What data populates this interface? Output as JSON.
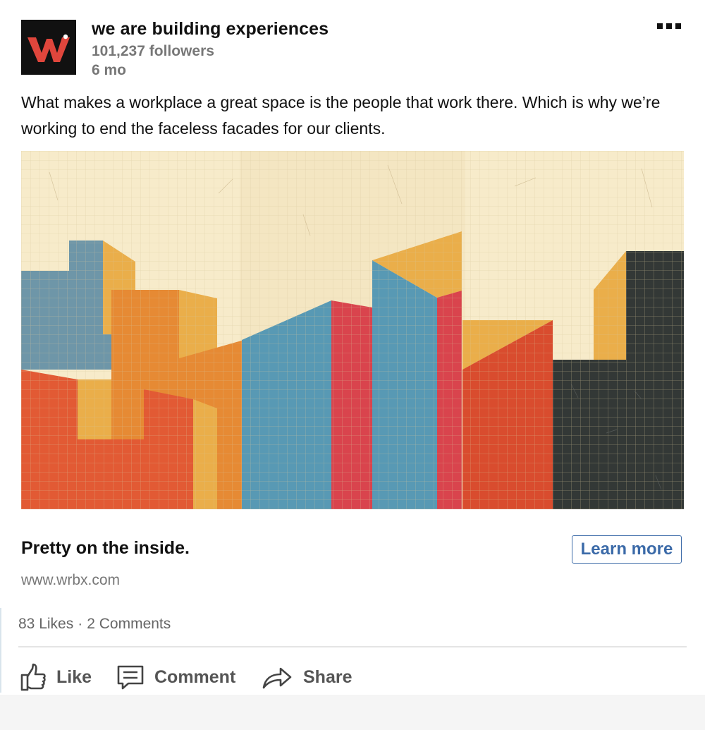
{
  "post": {
    "company_name": "we are building experiences",
    "followers": "101,237 followers",
    "age": "6 mo",
    "text": "What makes a workplace a great space is the people that work there. Which is why we’re working to end the faceless facades for our clients.",
    "logo_letter": "W",
    "more_icon": "ellipsis-icon"
  },
  "link_preview": {
    "headline": "Pretty on the inside.",
    "cta_label": "Learn more",
    "url": "www.wrbx.com"
  },
  "social": {
    "likes": "83 Likes",
    "separator": "·",
    "comments": "2 Comments"
  },
  "actions": {
    "like_label": "Like",
    "comment_label": "Comment",
    "share_label": "Share",
    "like_icon": "thumbs-up-icon",
    "comment_icon": "comment-bubble-icon",
    "share_icon": "share-arrow-icon"
  },
  "colors": {
    "brand_red": "#e0463c",
    "link_blue": "#3b6aa8",
    "paper": "#f7ebca",
    "grid": "#e2d3ac",
    "orange_red": "#e25a34",
    "orange": "#e68a34",
    "amber": "#eaae4a",
    "steel_blue": "#5899b4",
    "grey_blue": "#6e96a8",
    "crimson": "#d9444d",
    "brick": "#d94c2e",
    "charcoal": "#333836"
  }
}
